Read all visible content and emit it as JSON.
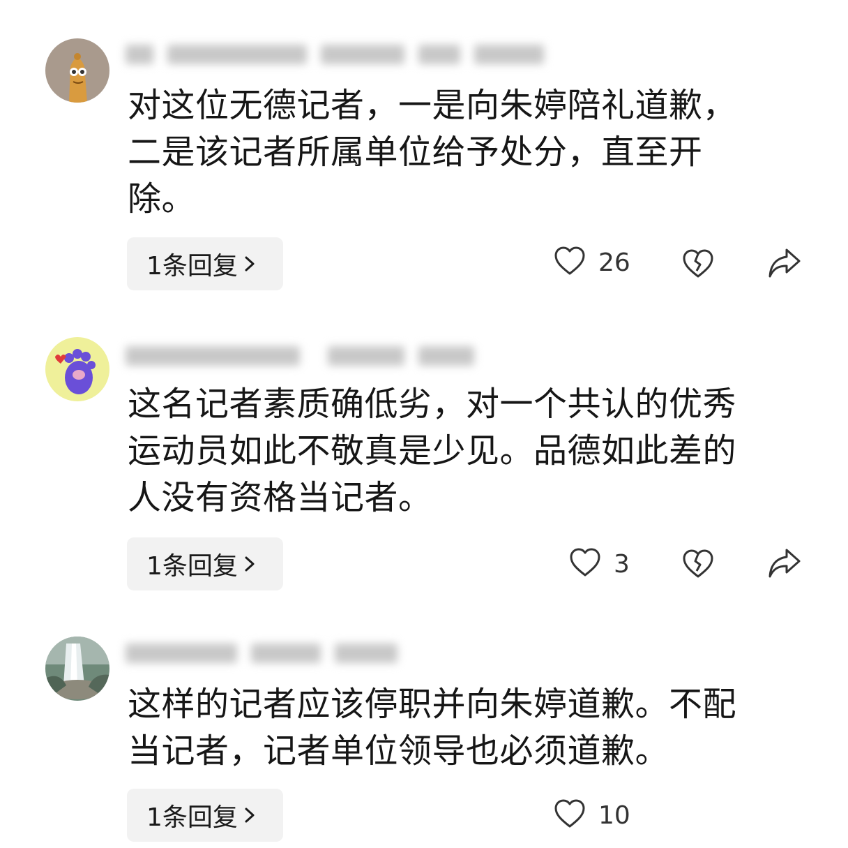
{
  "comments": [
    {
      "avatar": "snack-character-avatar",
      "text": "对这位无德记者，一是向朱婷陪礼道歉，\n二是该记者所属单位给予处分，直至开\n除。",
      "reply_label": "1条回复",
      "likes": "26",
      "has_dislike": true,
      "has_share": true
    },
    {
      "avatar": "purple-paw-avatar",
      "text": "这名记者素质确低劣，对一个共认的优秀\n运动员如此不敬真是少见。品德如此差的\n人没有资格当记者。",
      "reply_label": "1条回复",
      "likes": "3",
      "has_dislike": true,
      "has_share": true
    },
    {
      "avatar": "waterfall-avatar",
      "text": "这样的记者应该停职并向朱婷道歉。不配\n当记者，记者单位领导也必须道歉。",
      "reply_label": "1条回复",
      "likes": "10",
      "has_dislike": false,
      "has_share": false
    }
  ],
  "icons": {
    "like": "heart-outline-icon",
    "dislike": "broken-heart-icon",
    "share": "share-arrow-icon",
    "chevron": "chevron-right-icon"
  },
  "colors": {
    "text": "#161616",
    "reply_bg": "#f2f2f2",
    "icon": "#333333"
  }
}
